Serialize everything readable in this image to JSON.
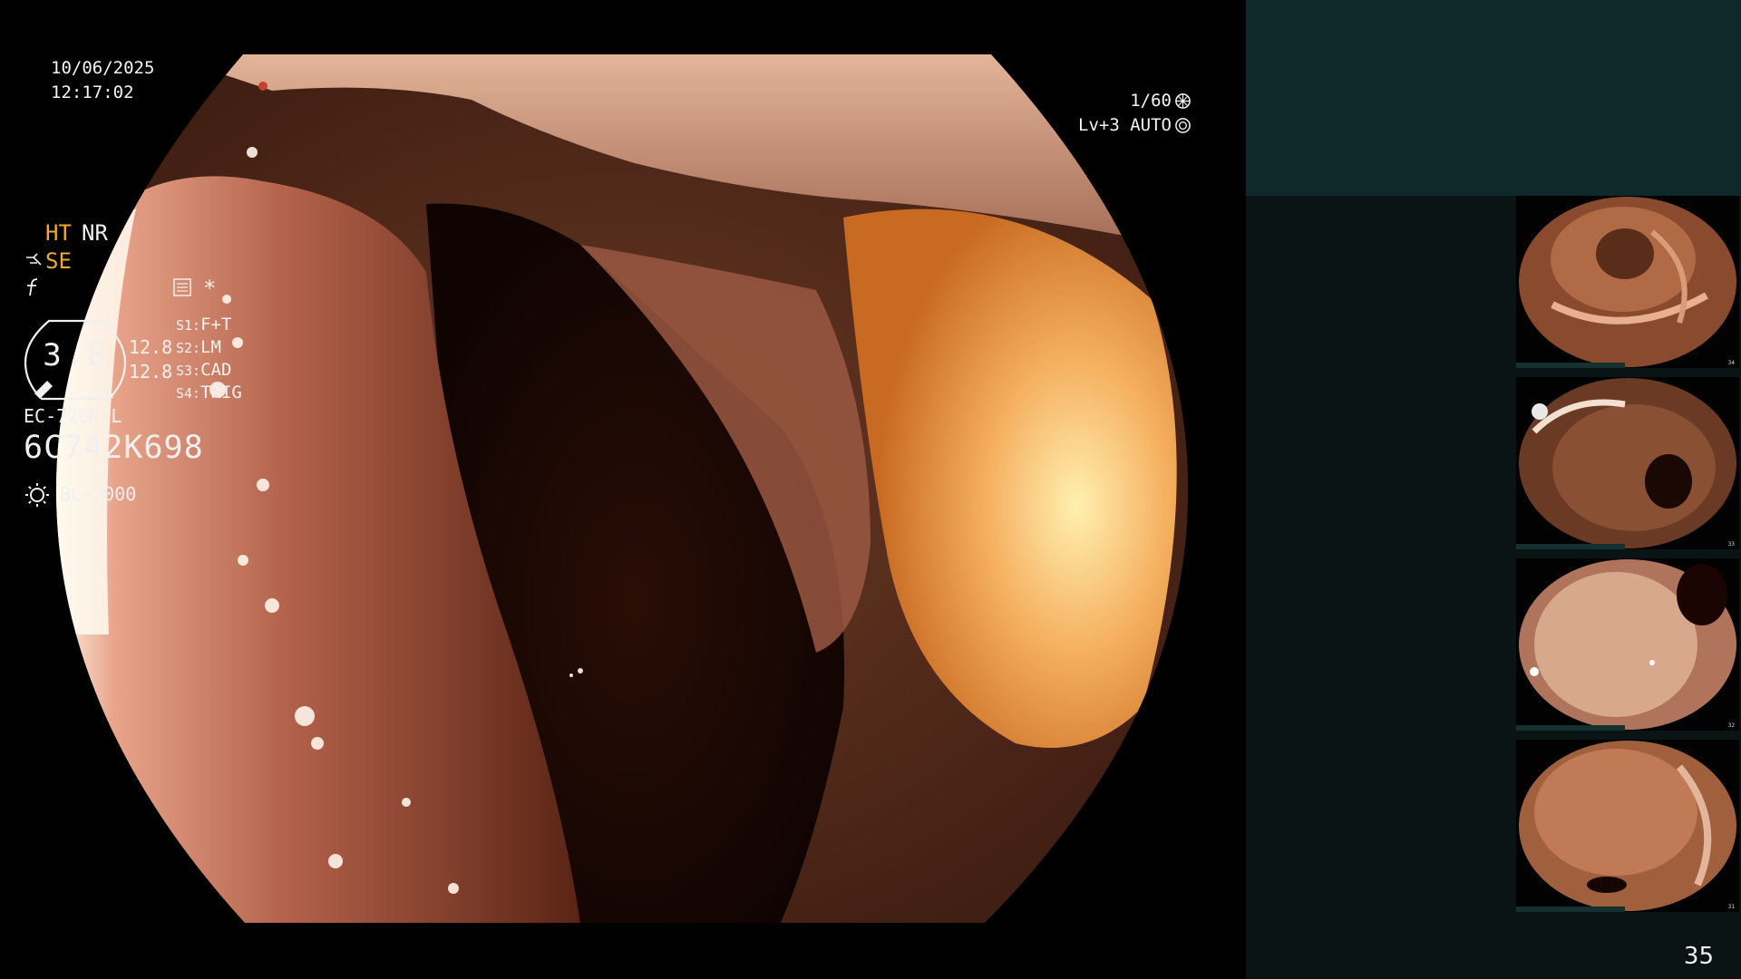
{
  "osd": {
    "date": "10/06/2025",
    "time": "12:17:02",
    "shutter": "1/60",
    "iris": "Lv+3 AUTO"
  },
  "panel": {
    "ht": "HT",
    "nr": "NR",
    "se": "SE",
    "star": "*",
    "gauge_value": "3.8",
    "gauge_right_1": "12.8",
    "gauge_right_2": "12.8",
    "slots": [
      {
        "key": "S1:",
        "value": "F+T"
      },
      {
        "key": "S2:",
        "value": "LM"
      },
      {
        "key": "S3:",
        "value": "CAD"
      },
      {
        "key": "S4:",
        "value": "TRIG"
      }
    ],
    "scope_model": "EC-720R/L",
    "scope_serial": "6C742K698",
    "light_source": "BL-7000",
    "frame_count": "35"
  },
  "thumbnails": [
    {
      "caption": "34"
    },
    {
      "caption": "33"
    },
    {
      "caption": "32"
    },
    {
      "caption": "31"
    }
  ],
  "colors": {
    "accent_orange": "#f0a830",
    "panel_top": "#0f2829",
    "panel_body": "#0a1415"
  }
}
